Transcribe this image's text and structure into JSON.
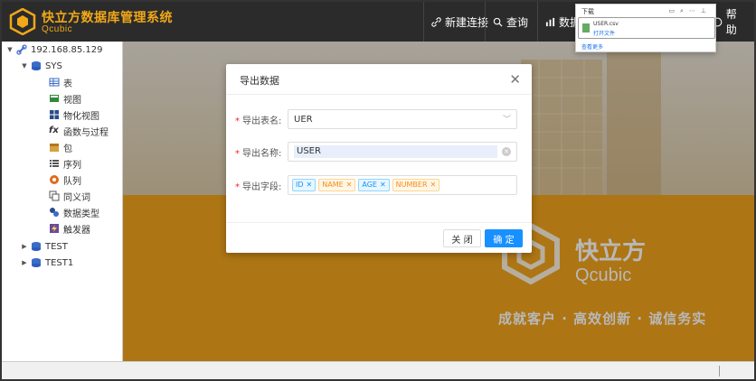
{
  "header": {
    "brand_title": "快立方数据库管理系统",
    "brand_sub": "Qcubic",
    "nav": {
      "new_connection": "新建连接",
      "query": "查询",
      "data": "数据",
      "help": "帮助"
    }
  },
  "sidebar": {
    "connection": "192.168.85.129",
    "db_sys": "SYS",
    "items": [
      {
        "label": "表",
        "icon": "table-icon"
      },
      {
        "label": "视图",
        "icon": "view-icon"
      },
      {
        "label": "物化视图",
        "icon": "materialized-view-icon"
      },
      {
        "label": "函数与过程",
        "icon": "function-icon"
      },
      {
        "label": "包",
        "icon": "package-icon"
      },
      {
        "label": "序列",
        "icon": "sequence-icon"
      },
      {
        "label": "队列",
        "icon": "queue-icon"
      },
      {
        "label": "同义词",
        "icon": "synonym-icon"
      },
      {
        "label": "数据类型",
        "icon": "datatype-icon"
      },
      {
        "label": "触发器",
        "icon": "trigger-icon"
      }
    ],
    "db_test": "TEST",
    "db_test1": "TEST1"
  },
  "background": {
    "brand": "快立方",
    "brand_sub": "Qcubic",
    "slogan": "成就客户 · 高效创新 · 诚信务实"
  },
  "modal": {
    "title": "导出数据",
    "table_label": "导出表名:",
    "table_value": "UER",
    "name_label": "导出名称:",
    "name_value": "USER",
    "fields_label": "导出字段:",
    "fields": [
      "ID",
      "NAME",
      "AGE",
      "NUMBER"
    ],
    "close_btn": "关 闭",
    "ok_btn": "确 定"
  },
  "download": {
    "title": "下载",
    "file_name": "USER.csv",
    "open_file": "打开文件",
    "see_more": "查看更多"
  },
  "colors": {
    "brand_orange": "#f0a21c",
    "primary_blue": "#1890ff",
    "header_bg": "#2b2b2b"
  }
}
